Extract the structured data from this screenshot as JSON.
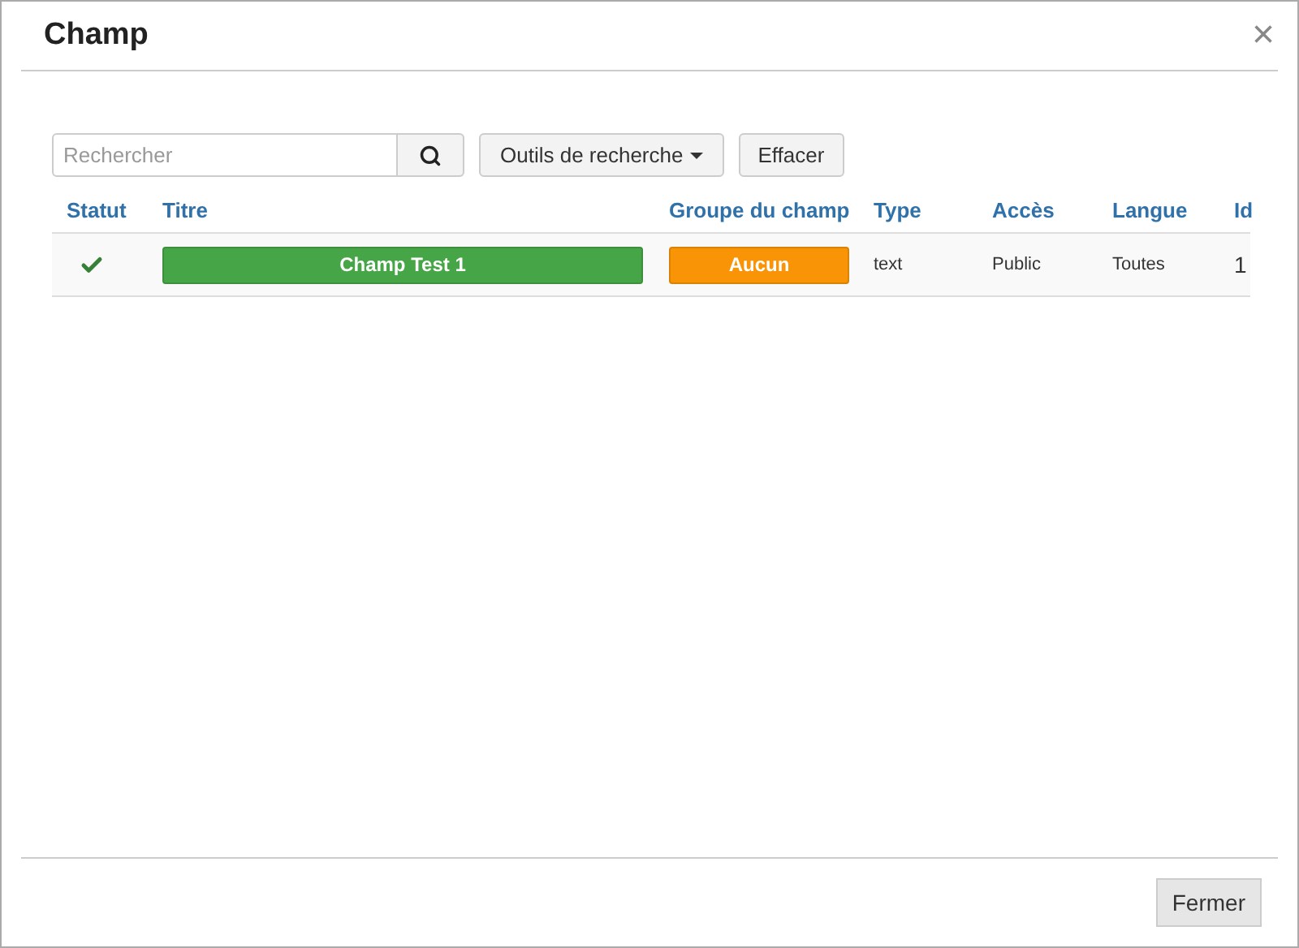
{
  "dialog": {
    "title": "Champ",
    "close": "×"
  },
  "toolbar": {
    "search": {
      "placeholder": "Rechercher"
    },
    "tools_button": "Outils de recherche",
    "clear_button": "Effacer"
  },
  "table": {
    "columns": [
      "Statut",
      "Titre",
      "Groupe du champ",
      "Type",
      "Accès",
      "Langue",
      "Id"
    ],
    "rows": [
      {
        "published": true,
        "title": "Champ Test 1",
        "group": "Aucun",
        "type": "text",
        "access": "Public",
        "language": "Toutes",
        "id": "1"
      }
    ]
  },
  "footer": {
    "close_button": "Fermer"
  }
}
